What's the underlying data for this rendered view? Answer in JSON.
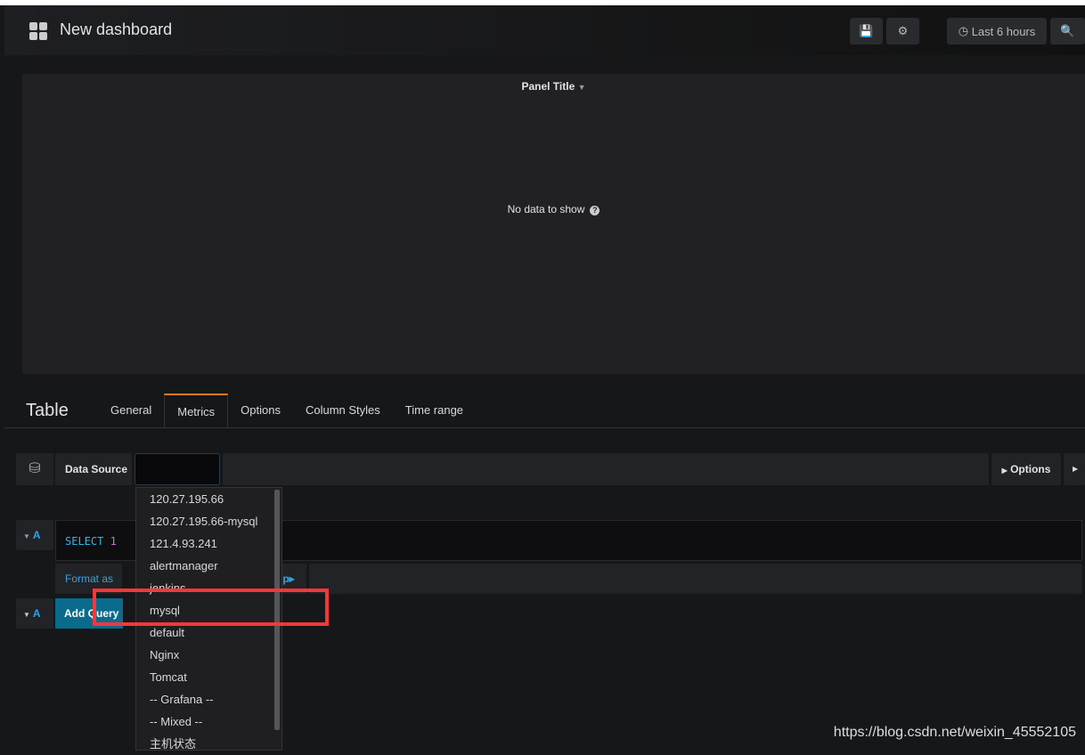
{
  "nav": {
    "title": "New dashboard",
    "time_range": "Last 6 hours"
  },
  "panel": {
    "title": "Panel Title",
    "no_data": "No data to show"
  },
  "editor": {
    "title": "Table",
    "tabs": [
      "General",
      "Metrics",
      "Options",
      "Column Styles",
      "Time range"
    ],
    "active_tab": "Metrics"
  },
  "metrics": {
    "data_source_label": "Data Source",
    "options_label": "Options",
    "query_letter": "A",
    "query_text_kw": "SELECT",
    "query_text_num": "1",
    "format_as": "Format as",
    "help_fragment": "lp",
    "add_query": "Add Query"
  },
  "dropdown": {
    "items": [
      "120.27.195.66",
      "120.27.195.66-mysql",
      "121.4.93.241",
      "alertmanager",
      "jenkins",
      "mysql",
      "default",
      "Nginx",
      "Tomcat",
      "-- Grafana --",
      "-- Mixed --",
      "主机状态"
    ],
    "highlighted": "mysql"
  },
  "watermark": "https://blog.csdn.net/weixin_45552105",
  "colors": {
    "highlight": "#f2383a",
    "active_tab": "#eb7b18",
    "add_query_bg": "#0b6b8d"
  }
}
